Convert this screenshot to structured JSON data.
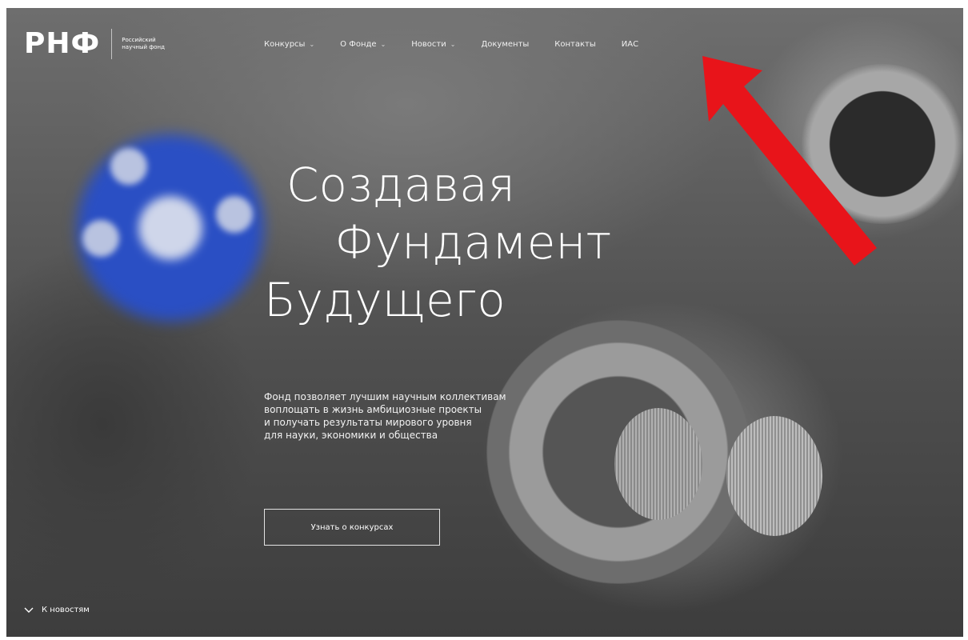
{
  "header": {
    "logo_mark": "РНФ",
    "logo_text": "Российский научный фонд",
    "nav": [
      {
        "label": "Конкурсы",
        "has_dropdown": true
      },
      {
        "label": "О Фонде",
        "has_dropdown": true
      },
      {
        "label": "Новости",
        "has_dropdown": true
      },
      {
        "label": "Документы",
        "has_dropdown": false
      },
      {
        "label": "Контакты",
        "has_dropdown": false
      },
      {
        "label": "ИАС",
        "has_dropdown": false
      }
    ]
  },
  "hero": {
    "title_line1": "Создавая",
    "title_line2": "Фундамент",
    "title_line3": "Будущего",
    "description_lines": [
      "Фонд позволяет лучшим научным коллективам",
      "воплощать в жизнь амбициозные проекты",
      "и получать результаты мирового уровня",
      "для науки, экономики и общества"
    ],
    "cta_label": "Узнать о конкурсах"
  },
  "footer_link": {
    "label": "К новостям",
    "icon": "chevron-down-icon"
  },
  "colors": {
    "annotation_arrow": "#e8141a",
    "gear": "#2a4fc4",
    "text": "#ffffff"
  }
}
